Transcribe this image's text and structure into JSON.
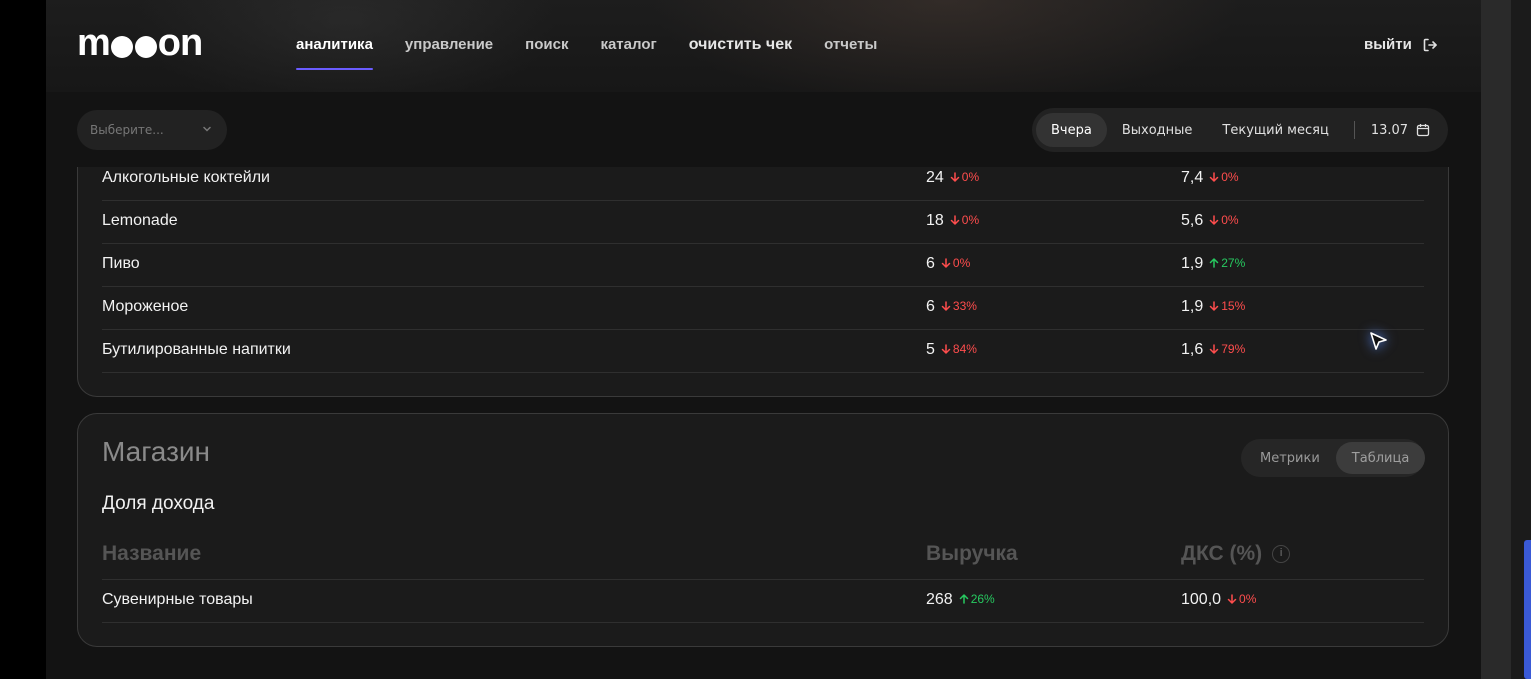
{
  "header": {
    "logo_text": "mooon",
    "nav": [
      {
        "label": "аналитика",
        "active": true
      },
      {
        "label": "управление"
      },
      {
        "label": "поиск"
      },
      {
        "label": "каталог"
      },
      {
        "label": "очистить чек"
      },
      {
        "label": "отчеты"
      }
    ],
    "logout_label": "выйти"
  },
  "filters": {
    "select_placeholder": "Выберите...",
    "periods": [
      "Вчера",
      "Выходные",
      "Текущий месяц"
    ],
    "active_period": "Вчера",
    "date": "13.07"
  },
  "top_table": {
    "rows": [
      {
        "name": "Алкогольные коктейли",
        "revenue": "24",
        "revenue_change": "0%",
        "revenue_dir": "down",
        "dks": "7,4",
        "dks_change": "0%",
        "dks_dir": "down"
      },
      {
        "name": "Lemonade",
        "revenue": "18",
        "revenue_change": "0%",
        "revenue_dir": "down",
        "dks": "5,6",
        "dks_change": "0%",
        "dks_dir": "down"
      },
      {
        "name": "Пиво",
        "revenue": "6",
        "revenue_change": "0%",
        "revenue_dir": "down",
        "dks": "1,9",
        "dks_change": "27%",
        "dks_dir": "up"
      },
      {
        "name": "Мороженое",
        "revenue": "6",
        "revenue_change": "33%",
        "revenue_dir": "down",
        "dks": "1,9",
        "dks_change": "15%",
        "dks_dir": "down"
      },
      {
        "name": "Бутилированные напитки",
        "revenue": "5",
        "revenue_change": "84%",
        "revenue_dir": "down",
        "dks": "1,6",
        "dks_change": "79%",
        "dks_dir": "down"
      }
    ]
  },
  "shop": {
    "title": "Магазин",
    "section_title": "Доля дохода",
    "toggle": [
      "Метрики",
      "Таблица"
    ],
    "active_toggle": "Таблица",
    "columns": {
      "name": "Название",
      "revenue": "Выручка",
      "dks": "ДКС (%)"
    },
    "rows": [
      {
        "name": "Сувенирные товары",
        "revenue": "268",
        "revenue_change": "26%",
        "revenue_dir": "up",
        "dks": "100,0",
        "dks_change": "0%",
        "dks_dir": "down"
      }
    ]
  },
  "colors": {
    "accent": "#6a5cff",
    "down": "#ff4d4d",
    "up": "#27c960",
    "background": "#131313"
  },
  "icons": {
    "logout": "logout-icon",
    "calendar": "calendar-icon",
    "chevron": "chevron-down-icon",
    "info": "info-icon",
    "cursor": "pointer-cursor-icon"
  }
}
